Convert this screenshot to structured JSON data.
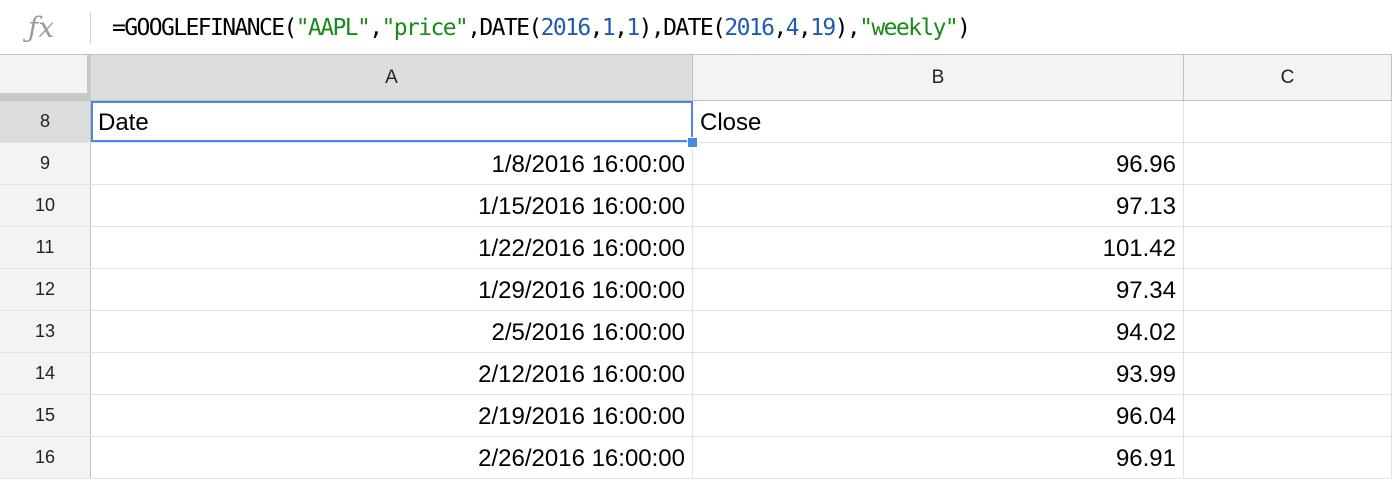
{
  "formula_bar": {
    "icon": "fx-icon",
    "tokens": [
      {
        "t": "=GOOGLEFINANCE(",
        "k": "plain"
      },
      {
        "t": "\"AAPL\"",
        "k": "str"
      },
      {
        "t": ",",
        "k": "plain"
      },
      {
        "t": "\"price\"",
        "k": "str"
      },
      {
        "t": ",DATE(",
        "k": "plain"
      },
      {
        "t": "2016",
        "k": "num"
      },
      {
        "t": ",",
        "k": "plain"
      },
      {
        "t": "1",
        "k": "num"
      },
      {
        "t": ",",
        "k": "plain"
      },
      {
        "t": "1",
        "k": "num"
      },
      {
        "t": "),DATE(",
        "k": "plain"
      },
      {
        "t": "2016",
        "k": "num"
      },
      {
        "t": ",",
        "k": "plain"
      },
      {
        "t": "4",
        "k": "num"
      },
      {
        "t": ",",
        "k": "plain"
      },
      {
        "t": "19",
        "k": "num"
      },
      {
        "t": "),",
        "k": "plain"
      },
      {
        "t": "\"weekly\"",
        "k": "str"
      },
      {
        "t": ")",
        "k": "plain"
      }
    ]
  },
  "columns": [
    "A",
    "B",
    "C"
  ],
  "rows": [
    {
      "num": "8",
      "a": "Date",
      "b": "Close",
      "c": ""
    },
    {
      "num": "9",
      "a": "1/8/2016 16:00:00",
      "b": "96.96",
      "c": ""
    },
    {
      "num": "10",
      "a": "1/15/2016 16:00:00",
      "b": "97.13",
      "c": ""
    },
    {
      "num": "11",
      "a": "1/22/2016 16:00:00",
      "b": "101.42",
      "c": ""
    },
    {
      "num": "12",
      "a": "1/29/2016 16:00:00",
      "b": "97.34",
      "c": ""
    },
    {
      "num": "13",
      "a": "2/5/2016 16:00:00",
      "b": "94.02",
      "c": ""
    },
    {
      "num": "14",
      "a": "2/12/2016 16:00:00",
      "b": "93.99",
      "c": ""
    },
    {
      "num": "15",
      "a": "2/19/2016 16:00:00",
      "b": "96.04",
      "c": ""
    },
    {
      "num": "16",
      "a": "2/26/2016 16:00:00",
      "b": "96.91",
      "c": ""
    }
  ],
  "colors": {
    "selection": "#4a86e8",
    "string_token": "#1a8a1a",
    "number_token": "#1f5cad"
  }
}
